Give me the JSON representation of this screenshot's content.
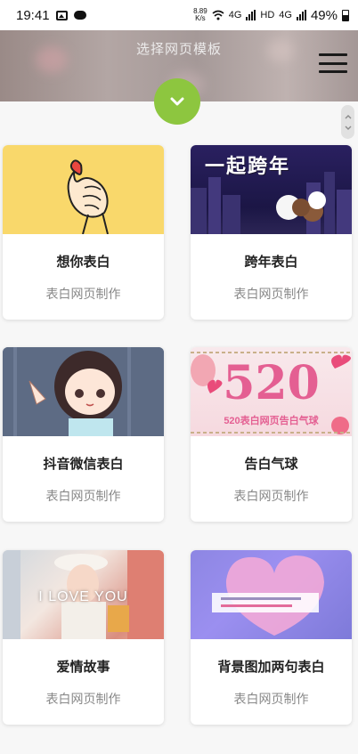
{
  "status_bar": {
    "time": "19:41",
    "speed_value": "8.89",
    "speed_unit": "K/s",
    "net_a": "4G",
    "net_b": "HD",
    "net_c": "4G",
    "battery": "49%"
  },
  "header": {
    "title": "选择网页模板",
    "menu_icon": "hamburger-menu-icon",
    "expand_icon": "chevron-down-icon",
    "accent_color": "#8dc63f"
  },
  "templates": [
    {
      "title": "想你表白",
      "subtitle": "表白网页制作"
    },
    {
      "title": "跨年表白",
      "subtitle": "表白网页制作",
      "image_text": "一起跨年"
    },
    {
      "title": "抖音微信表白",
      "subtitle": "表白网页制作"
    },
    {
      "title": "告白气球",
      "subtitle": "表白网页制作",
      "image_text": "520",
      "image_caption": "520表白网页告白气球"
    },
    {
      "title": "爱情故事",
      "subtitle": "表白网页制作",
      "image_text": "I LOVE YOU"
    },
    {
      "title": "背景图加两句表白",
      "subtitle": "表白网页制作"
    }
  ]
}
